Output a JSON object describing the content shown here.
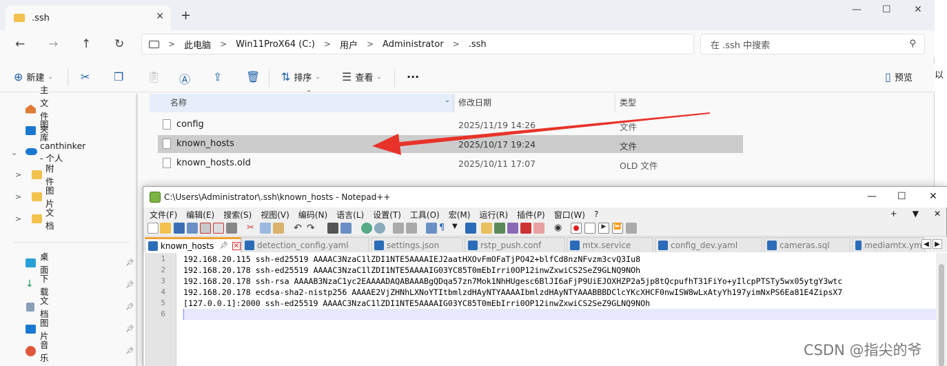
{
  "explorer": {
    "tab_title": ".ssh",
    "breadcrumb": [
      "此电脑",
      "Win11ProX64 (C:)",
      "用户",
      "Administrator",
      ".ssh"
    ],
    "search_placeholder": "在 .ssh 中搜索",
    "toolbar": {
      "new_label": "新建",
      "sort_label": "排序",
      "view_label": "查看",
      "preview_label": "预览"
    },
    "sidebar": {
      "items": [
        {
          "label": "主文件夹",
          "icon": "home-icon"
        },
        {
          "label": "图库",
          "icon": "gallery-icon"
        },
        {
          "label": "canthinker - 个人",
          "icon": "cloud-icon"
        },
        {
          "label": "附件",
          "icon": "folder-icon"
        },
        {
          "label": "图片",
          "icon": "folder-icon"
        },
        {
          "label": "文档",
          "icon": "folder-icon"
        }
      ],
      "quick_access": [
        {
          "label": "桌面",
          "icon": "desktop-icon"
        },
        {
          "label": "下载",
          "icon": "download-icon"
        },
        {
          "label": "文档",
          "icon": "documents-icon"
        },
        {
          "label": "图片",
          "icon": "pictures-icon"
        },
        {
          "label": "音乐",
          "icon": "music-icon"
        }
      ]
    },
    "columns": {
      "name": "名称",
      "date": "修改日期",
      "type": "类型"
    },
    "files": [
      {
        "name": "config",
        "date": "2025/11/19 14:26",
        "type": "文件"
      },
      {
        "name": "known_hosts",
        "date": "2025/10/17 19:24",
        "type": "文件"
      },
      {
        "name": "known_hosts.old",
        "date": "2025/10/11 17:07",
        "type": "OLD 文件"
      }
    ],
    "edge_text": "以"
  },
  "notepad": {
    "title": "C:\\Users\\Administrator\\.ssh\\known_hosts - Notepad++",
    "menu": [
      "文件(F)",
      "编辑(E)",
      "搜索(S)",
      "视图(V)",
      "编码(N)",
      "语言(L)",
      "设置(T)",
      "工具(O)",
      "宏(M)",
      "运行(R)",
      "插件(P)",
      "窗口(W)",
      "?"
    ],
    "menu_right": [
      "+",
      "▼",
      "✕"
    ],
    "tabs": [
      "known_hosts",
      "detection_config.yaml",
      "settings.json",
      "rstp_push.conf",
      "mtx.service",
      "config_dev.yaml",
      "cameras.sql",
      "mediamtx.yml"
    ],
    "lines": [
      "192.168.20.115 ssh-ed25519 AAAAC3NzaC1lZDI1NTE5AAAAIEJ2aatHXOvFmOFaTjPO42+blfCd8nzNFvzm3cvQ3Iu8",
      "192.168.20.178 ssh-ed25519 AAAAC3NzaC1lZDI1NTE5AAAAIG03YC85T0mEbIrri0OP12inwZxwiCS2SeZ9GLNQ9NOh",
      "192.168.20.178 ssh-rsa AAAAB3NzaC1yc2EAAAADAQABAAABgQDqa57zn7Mok1NhHUgesc6BlJI6aFjP9UiEJOXHZP2a5jp8tQcpufhT31FiYo+yIlcpPTSTy5wx05ytgY3wtc",
      "192.168.20.178 ecdsa-sha2-nistp256 AAAAE2VjZHNhLXNoYTItbmlzdHAyNTYAAAAIbmlzdHAyNTYAAABBBDClcYKcXHCF0nwISW8wLxAtyYh197yimNxPS6Ea81E4ZipsX7",
      "[127.0.0.1]:2000 ssh-ed25519 AAAAC3NzaC1lZDI1NTE5AAAAIG03YC85T0mEbIrri0OP12inwZxwiCS2SeZ9GLNQ9NOh",
      ""
    ],
    "line_numbers": [
      "1",
      "2",
      "3",
      "4",
      "5",
      "6"
    ]
  },
  "watermark": "CSDN @指尖的爷",
  "colors": {
    "arrow": "#e8332a",
    "accent": "#1c5ea8",
    "selected_row": "#cccccc"
  }
}
